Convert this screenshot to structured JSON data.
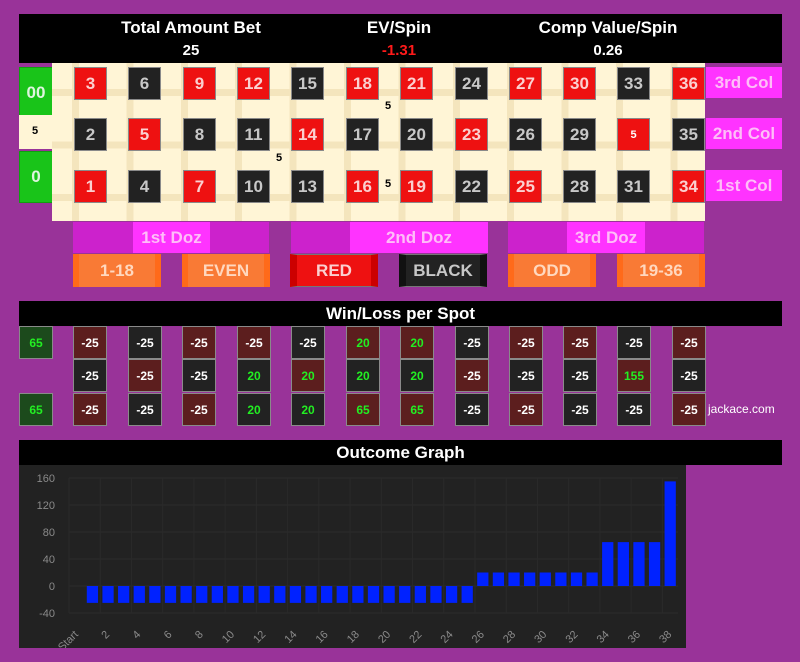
{
  "header": {
    "total_bet_label": "Total Amount Bet",
    "total_bet_value": "25",
    "ev_label": "EV/Spin",
    "ev_value": "-1.31",
    "comp_label": "Comp Value/Spin",
    "comp_value": "0.26"
  },
  "colors": {
    "background": "#993399",
    "red": "#ee1111",
    "black": "#222222",
    "green": "#19c419",
    "magenta": "#ff33ff",
    "orange": "#f97a35",
    "bar": "#0022ff",
    "win_text": "#22ee22"
  },
  "table": {
    "zeros": [
      {
        "label": "00"
      },
      {
        "label": "0"
      }
    ],
    "rows": [
      [
        {
          "n": "3",
          "c": "red"
        },
        {
          "n": "6",
          "c": "black"
        },
        {
          "n": "9",
          "c": "red"
        },
        {
          "n": "12",
          "c": "red"
        },
        {
          "n": "15",
          "c": "black"
        },
        {
          "n": "18",
          "c": "red"
        },
        {
          "n": "21",
          "c": "red"
        },
        {
          "n": "24",
          "c": "black"
        },
        {
          "n": "27",
          "c": "red"
        },
        {
          "n": "30",
          "c": "red"
        },
        {
          "n": "33",
          "c": "black"
        },
        {
          "n": "36",
          "c": "red"
        }
      ],
      [
        {
          "n": "2",
          "c": "black"
        },
        {
          "n": "5",
          "c": "red"
        },
        {
          "n": "8",
          "c": "black"
        },
        {
          "n": "11",
          "c": "black"
        },
        {
          "n": "14",
          "c": "red"
        },
        {
          "n": "17",
          "c": "black"
        },
        {
          "n": "20",
          "c": "black"
        },
        {
          "n": "23",
          "c": "red"
        },
        {
          "n": "26",
          "c": "black"
        },
        {
          "n": "29",
          "c": "black"
        },
        {
          "n": "5",
          "c": "red",
          "chip": true
        },
        {
          "n": "35",
          "c": "black"
        }
      ],
      [
        {
          "n": "1",
          "c": "red"
        },
        {
          "n": "4",
          "c": "black"
        },
        {
          "n": "7",
          "c": "red"
        },
        {
          "n": "10",
          "c": "black"
        },
        {
          "n": "13",
          "c": "black"
        },
        {
          "n": "16",
          "c": "red"
        },
        {
          "n": "19",
          "c": "red"
        },
        {
          "n": "22",
          "c": "black"
        },
        {
          "n": "25",
          "c": "red"
        },
        {
          "n": "28",
          "c": "black"
        },
        {
          "n": "31",
          "c": "black"
        },
        {
          "n": "34",
          "c": "red"
        }
      ]
    ],
    "chips": [
      {
        "bet": "split 0/00",
        "amount": "5"
      },
      {
        "bet": "corner 17/18/20/21",
        "amount": "5"
      },
      {
        "bet": "corner 10/11/13/14",
        "amount": "5"
      },
      {
        "bet": "split 16/19",
        "amount": "5"
      },
      {
        "bet": "straight 32",
        "amount": "5"
      }
    ],
    "columns": [
      "3rd Col",
      "2nd Col",
      "1st Col"
    ],
    "dozens": [
      "1st Doz",
      "2nd Doz",
      "3rd Doz"
    ],
    "outside": [
      {
        "label": "1-18",
        "style": "orange"
      },
      {
        "label": "EVEN",
        "style": "orange"
      },
      {
        "label": "RED",
        "style": "redb"
      },
      {
        "label": "BLACK",
        "style": "blackb"
      },
      {
        "label": "ODD",
        "style": "orange"
      },
      {
        "label": "19-36",
        "style": "orange"
      }
    ]
  },
  "winloss": {
    "title": "Win/Loss per Spot",
    "zeros": [
      "65",
      "65"
    ],
    "rows": [
      [
        "-25",
        "-25",
        "-25",
        "-25",
        "-25",
        "20",
        "20",
        "-25",
        "-25",
        "-25",
        "-25",
        "-25"
      ],
      [
        "-25",
        "-25",
        "-25",
        "20",
        "20",
        "20",
        "20",
        "-25",
        "-25",
        "-25",
        "155",
        "-25"
      ],
      [
        "-25",
        "-25",
        "-25",
        "20",
        "20",
        "65",
        "65",
        "-25",
        "-25",
        "-25",
        "-25",
        "-25"
      ]
    ],
    "site": "jackace.com"
  },
  "chart_data": {
    "type": "bar",
    "title": "Outcome Graph",
    "xlabel": "",
    "ylabel": "",
    "ylim": [
      -40,
      160
    ],
    "yticks": [
      160,
      120,
      80,
      40,
      0,
      -40
    ],
    "x_tick_labels": [
      "Start",
      "2",
      "4",
      "6",
      "8",
      "10",
      "12",
      "14",
      "16",
      "18",
      "20",
      "22",
      "24",
      "26",
      "28",
      "30",
      "32",
      "34",
      "36",
      "38"
    ],
    "x": [
      1,
      2,
      3,
      4,
      5,
      6,
      7,
      8,
      9,
      10,
      11,
      12,
      13,
      14,
      15,
      16,
      17,
      18,
      19,
      20,
      21,
      22,
      23,
      24,
      25,
      26,
      27,
      28,
      29,
      30,
      31,
      32,
      33,
      34,
      35,
      36,
      37,
      38
    ],
    "values": [
      -25,
      -25,
      -25,
      -25,
      -25,
      -25,
      -25,
      -25,
      -25,
      -25,
      -25,
      -25,
      -25,
      -25,
      -25,
      -25,
      -25,
      -25,
      -25,
      -25,
      -25,
      -25,
      -25,
      -25,
      -25,
      20,
      20,
      20,
      20,
      20,
      20,
      20,
      20,
      65,
      65,
      65,
      65,
      155
    ],
    "grid": true,
    "legend": "none"
  }
}
